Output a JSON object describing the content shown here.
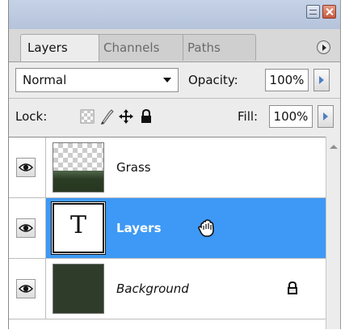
{
  "tabs": [
    {
      "label": "Layers",
      "active": true
    },
    {
      "label": "Channels",
      "active": false
    },
    {
      "label": "Paths",
      "active": false
    }
  ],
  "blend_mode": {
    "value": "Normal"
  },
  "opacity": {
    "label": "Opacity:",
    "value": "100%"
  },
  "lock": {
    "label": "Lock:",
    "icons": [
      "lock-transparent-pixels-icon",
      "lock-image-pixels-icon",
      "lock-position-icon",
      "lock-all-icon"
    ]
  },
  "fill": {
    "label": "Fill:",
    "value": "100%"
  },
  "layers": [
    {
      "name": "Grass",
      "thumbnail": "transparent-with-grass",
      "visible": true,
      "selected": false
    },
    {
      "name": "Layers",
      "thumbnail": "text-layer",
      "visible": true,
      "selected": true
    },
    {
      "name": "Background",
      "thumbnail": "dark-green-fill",
      "visible": true,
      "selected": false,
      "locked": true
    }
  ],
  "colors": {
    "selection": "#3d99f5",
    "title_bar": "#b5c3db",
    "background_layer": "#2f3c2a"
  }
}
